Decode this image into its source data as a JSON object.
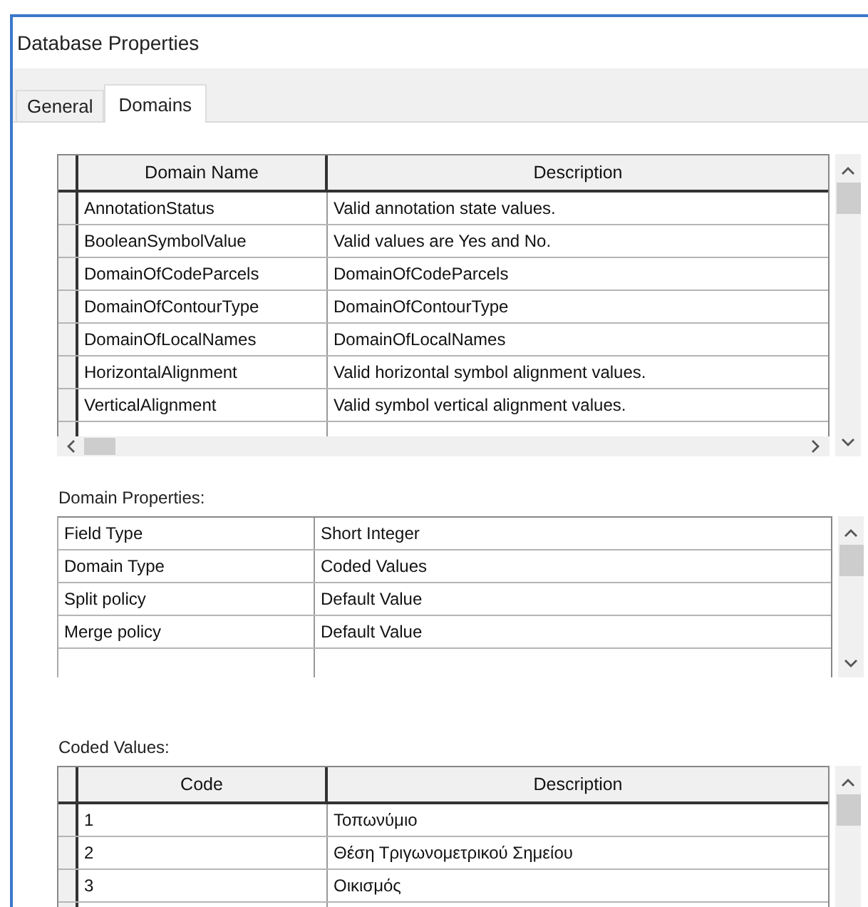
{
  "window": {
    "title": "Database Properties"
  },
  "tabs": [
    {
      "label": "General",
      "selected": false
    },
    {
      "label": "Domains",
      "selected": true
    }
  ],
  "domains_table": {
    "columns": [
      "Domain Name",
      "Description"
    ],
    "rows": [
      [
        "AnnotationStatus",
        "Valid annotation state values."
      ],
      [
        "BooleanSymbolValue",
        "Valid values are Yes and No."
      ],
      [
        "DomainOfCodeParcels",
        "DomainOfCodeParcels"
      ],
      [
        "DomainOfContourType",
        "DomainOfContourType"
      ],
      [
        "DomainOfLocalNames",
        "DomainOfLocalNames"
      ],
      [
        "HorizontalAlignment",
        "Valid horizontal symbol alignment values."
      ],
      [
        "VerticalAlignment",
        "Valid symbol vertical alignment values."
      ]
    ]
  },
  "domain_properties": {
    "label": "Domain Properties:",
    "rows": [
      [
        "Field Type",
        "Short Integer"
      ],
      [
        "Domain Type",
        "Coded Values"
      ],
      [
        "Split policy",
        "Default Value"
      ],
      [
        "Merge policy",
        "Default Value"
      ]
    ]
  },
  "coded_values": {
    "label": "Coded Values:",
    "columns": [
      "Code",
      "Description"
    ],
    "rows": [
      [
        "1",
        "Τοπωνύμιο"
      ],
      [
        "2",
        "Θέση Τριγωνομετρικού Σημείου"
      ],
      [
        "3",
        "Οικισμός"
      ]
    ]
  }
}
